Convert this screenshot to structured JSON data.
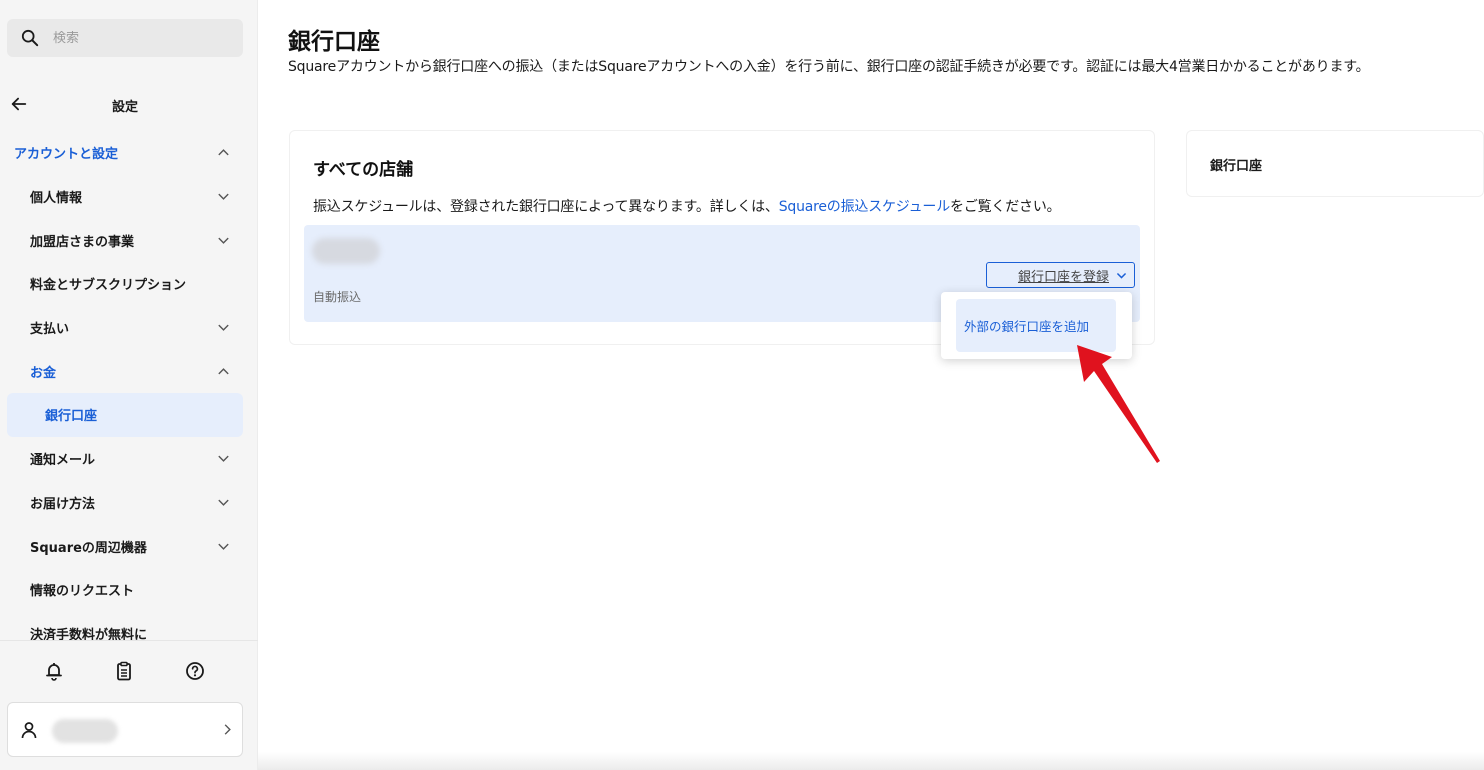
{
  "sidebar": {
    "search_placeholder": "検索",
    "title": "設定",
    "items": [
      {
        "label": "アカウントと設定",
        "kind": "section",
        "chevron": "up"
      },
      {
        "label": "個人情報",
        "kind": "item",
        "chevron": "down"
      },
      {
        "label": "加盟店さまの事業",
        "kind": "item",
        "chevron": "down"
      },
      {
        "label": "料金とサブスクリプション",
        "kind": "item",
        "chevron": ""
      },
      {
        "label": "支払い",
        "kind": "item",
        "chevron": "down"
      },
      {
        "label": "お金",
        "kind": "active-parent",
        "chevron": "up"
      },
      {
        "label": "銀行口座",
        "kind": "selected",
        "chevron": ""
      },
      {
        "label": "通知メール",
        "kind": "item",
        "chevron": "down"
      },
      {
        "label": "お届け方法",
        "kind": "item",
        "chevron": "down"
      },
      {
        "label": "Squareの周辺機器",
        "kind": "item",
        "chevron": "down"
      },
      {
        "label": "情報のリクエスト",
        "kind": "item",
        "chevron": ""
      },
      {
        "label": "決済手数料が無料に",
        "kind": "item",
        "chevron": ""
      }
    ],
    "footer_icons": [
      "bell-icon",
      "clipboard-icon",
      "help-icon"
    ]
  },
  "main": {
    "title": "銀行口座",
    "subtitle": "Squareアカウントから銀行口座への振込（またはSquareアカウントへの入金）を行う前に、銀行口座の認証手続きが必要です。認証には最大4営業日かかることがあります。",
    "card": {
      "title": "すべての店舗",
      "desc_before": "振込スケジュールは、登録された銀行口座によって異なります。詳しくは、",
      "desc_link": "Squareの振込スケジュール",
      "desc_after": "をご覧ください。",
      "auto_label": "自動振込",
      "register_button": "銀行口座を登録"
    },
    "side_card_title": "銀行口座",
    "dropdown_item": "外部の銀行口座を追加"
  },
  "colors": {
    "accent": "#1a5fd6",
    "selected_bg": "#e6eefc",
    "annotation_arrow": "#e0121e"
  }
}
